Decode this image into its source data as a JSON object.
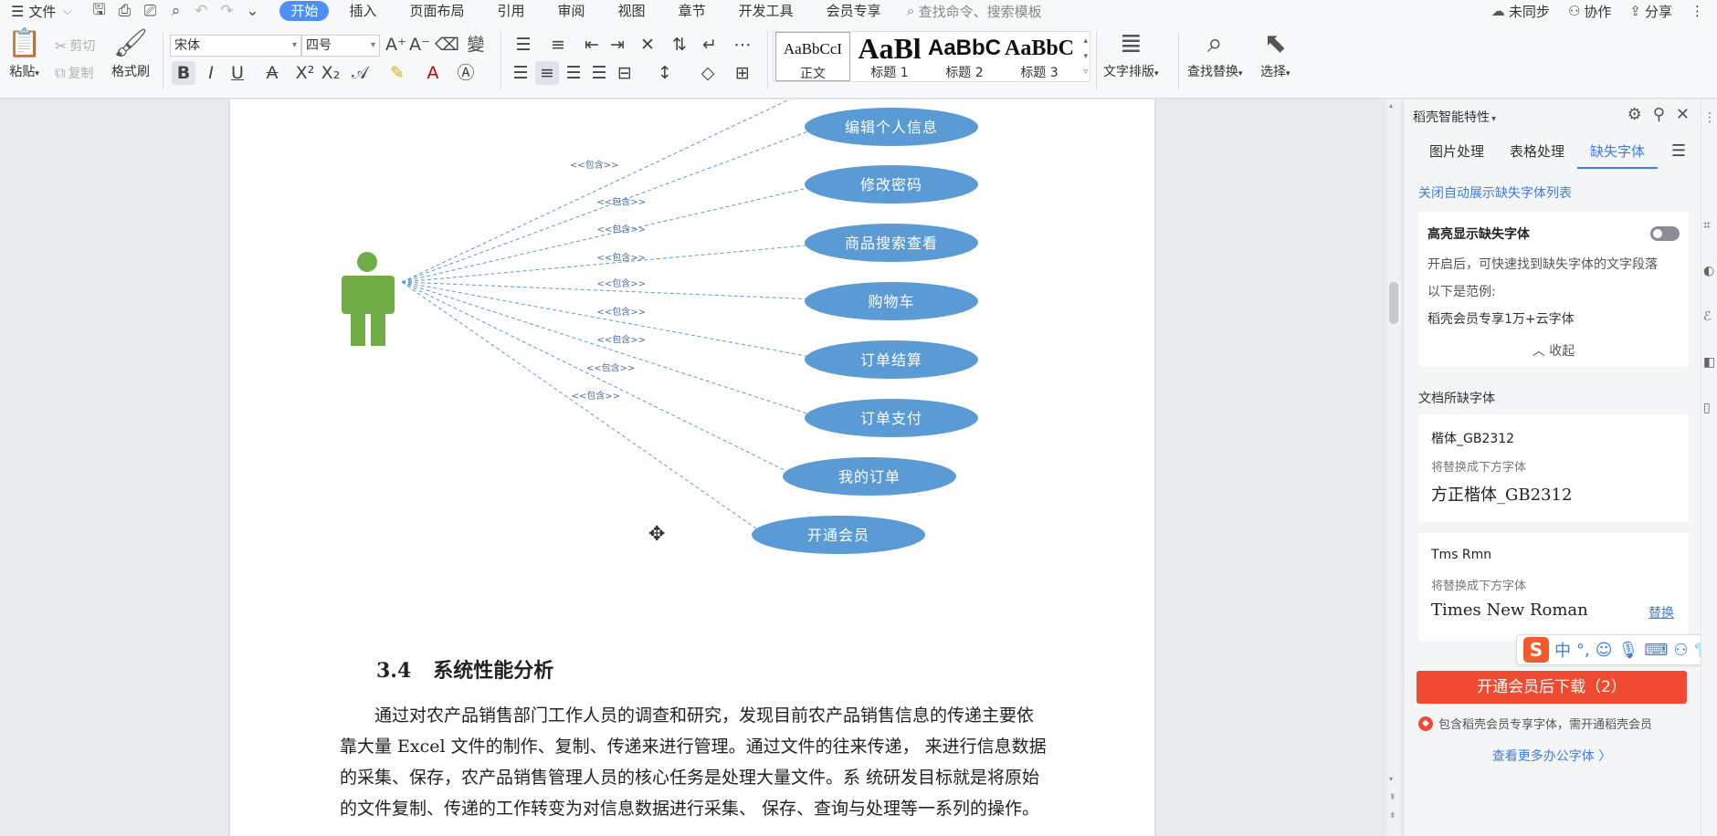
{
  "menu": {
    "file_label": "文件",
    "tabs": [
      "开始",
      "插入",
      "页面布局",
      "引用",
      "审阅",
      "视图",
      "章节",
      "开发工具",
      "会员专享"
    ],
    "search_placeholder": "查找命令、搜索模板",
    "right": {
      "sync": "未同步",
      "collab": "协作",
      "share": "分享"
    }
  },
  "ribbon": {
    "paste": "粘贴",
    "cut": "剪切",
    "copy": "复制",
    "format_painter": "格式刷",
    "font_name": "宋体",
    "font_size": "四号",
    "styles": [
      {
        "sample": "AaBbCcI",
        "label": "正文"
      },
      {
        "sample": "AaBl",
        "label": "标题 1"
      },
      {
        "sample": "AaBbC",
        "label": "标题 2"
      },
      {
        "sample": "AaBbC",
        "label": "标题 3"
      }
    ],
    "text_layout": "文字排版",
    "find_replace": "查找替换",
    "select": "选择"
  },
  "diagram": {
    "include_label": "<<包含>>",
    "use_cases": [
      "编辑个人信息",
      "修改密码",
      "商品搜索查看",
      "购物车",
      "订单结算",
      "订单支付",
      "我的订单",
      "开通会员"
    ]
  },
  "document": {
    "section_number": "3.4",
    "section_title": "系统性能分析",
    "lines": [
      "通过对农产品销售部门工作人员的调查和研究，发现目前农产品销售信息的传递主要依",
      "靠大量 Excel 文件的制作、复制、传递来进行管理。通过文件的往来传递， 来进行信息数据",
      "的采集、保存，农产品销售管理人员的核心任务是处理大量文件。系 统研发目标就是将原始",
      "的文件复制、传递的工作转变为对信息数据进行采集、 保存、查询与处理等一系列的操作。"
    ]
  },
  "panel": {
    "title": "稻壳智能特性",
    "tabs": [
      "图片处理",
      "表格处理",
      "缺失字体"
    ],
    "close_auto_link": "关闭自动展示缺失字体列表",
    "highlight_title": "高亮显示缺失字体",
    "highlight_desc": "开启后，可快速找到缺失字体的文字段落",
    "example_label": "以下是范例:",
    "example_text": "稻壳会员专享1万+云字体",
    "collapse": "收起",
    "missing_section": "文档所缺字体",
    "fonts": [
      {
        "name": "楷体_GB2312",
        "replace_label": "将替换成下方字体",
        "replacement": "方正楷体_GB2312"
      },
      {
        "name": "Tms Rmn",
        "replace_label": "将替换成下方字体",
        "replacement": "Times New Roman",
        "action": "替换"
      }
    ],
    "download_button": "开通会员后下载（2）",
    "member_note": "包含稻壳会员专享字体，需开通稻壳会员",
    "more_fonts": "查看更多办公字体 〉"
  },
  "colors": {
    "accent": "#4d8ff7",
    "ellipse": "#5b9bd5",
    "actor": "#70ad47",
    "download": "#f04a32"
  }
}
